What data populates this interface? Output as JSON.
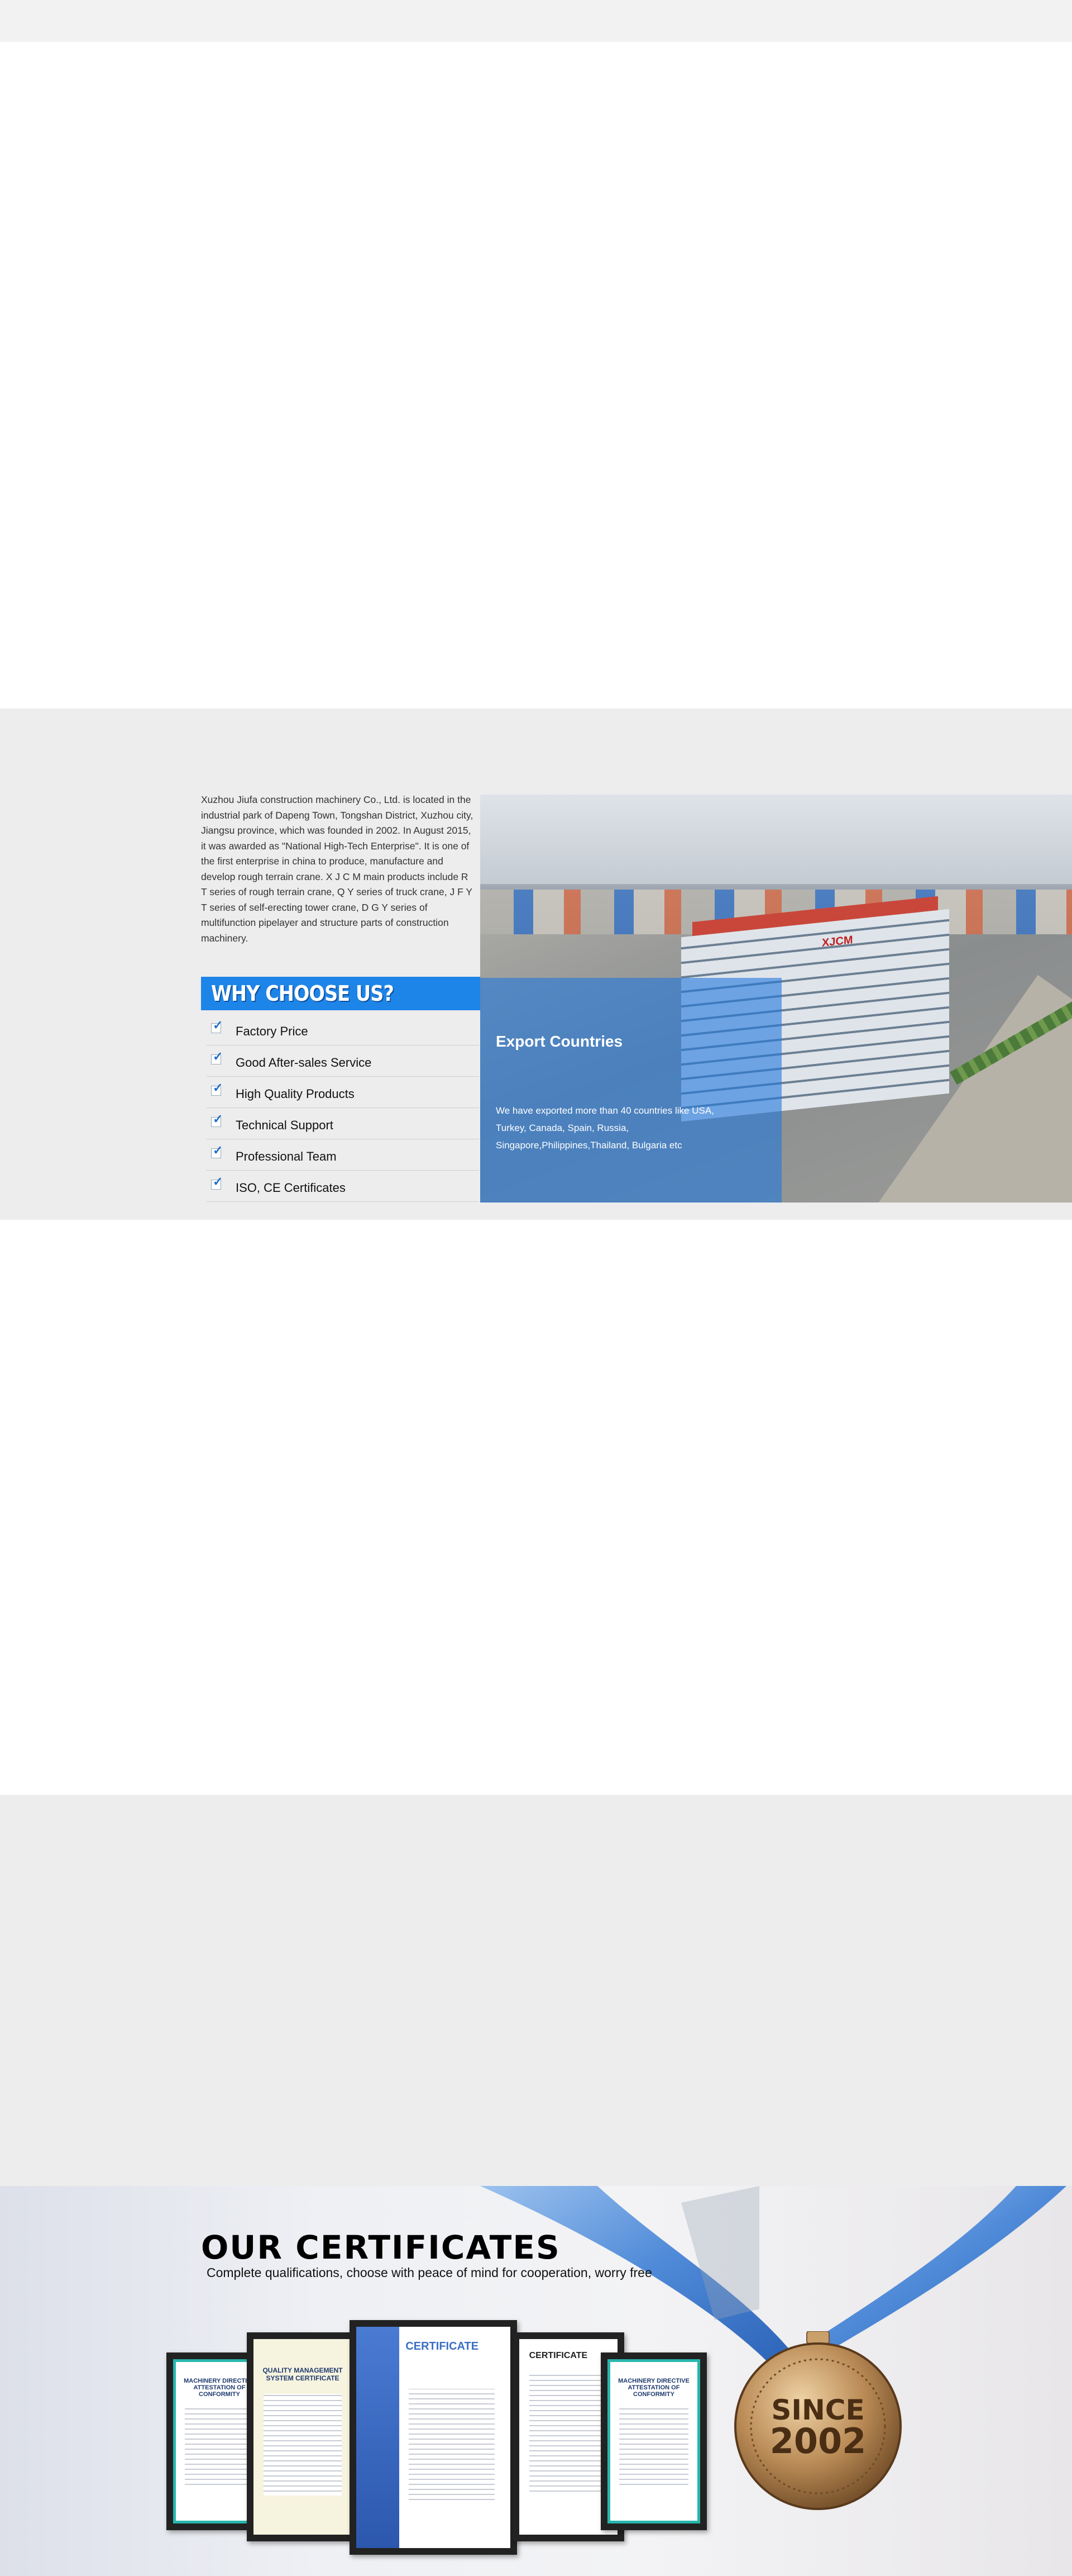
{
  "about": {
    "intro": "Xuzhou Jiufa construction machinery Co., Ltd. is located in the industrial park of Dapeng Town, Tongshan District, Xuzhou city, Jiangsu province, which was founded in 2002. In August 2015, it was awarded as \"National High-Tech Enterprise\". It is one of the first enterprise in china to produce, manufacture and develop rough terrain crane. X J C M main products include R T series of rough terrain crane, Q Y series of truck crane, J F Y T series of self-erecting tower crane, D G Y series of multifunction pipelayer and structure parts of construction machinery.",
    "why_title": "WHY CHOOSE US?",
    "why_items": [
      "Factory Price",
      "Good After-sales Service",
      "High Quality Products",
      "Technical Support",
      "Professional Team",
      "ISO, CE Certificates"
    ],
    "photo_sign": "XJCM",
    "export_title": "Export Countries",
    "export_text": "We have exported more than 40 countries  like USA, Turkey, Canada, Spain, Russia, Singapore,Philippines,Thailand, Bulgaria etc"
  },
  "certificates": {
    "title": "OUR CERTIFICATES",
    "subtitle": "Complete qualifications, choose with peace of mind for cooperation, worry free",
    "cards": {
      "c1": "MACHINERY DIRECTIVE ATTESTATION OF CONFORMITY",
      "c2": "QUALITY MANAGEMENT SYSTEM CERTIFICATE",
      "c3": "CERTIFICATE",
      "c4": "CERTIFICATE",
      "c5": "MACHINERY DIRECTIVE ATTESTATION OF CONFORMITY"
    },
    "medal_line1": "SINCE",
    "medal_line2": "2002"
  },
  "colors": {
    "accent_blue": "#1e85e8",
    "band_gray": "#ededed",
    "medal_bronze": "#b98a55"
  }
}
